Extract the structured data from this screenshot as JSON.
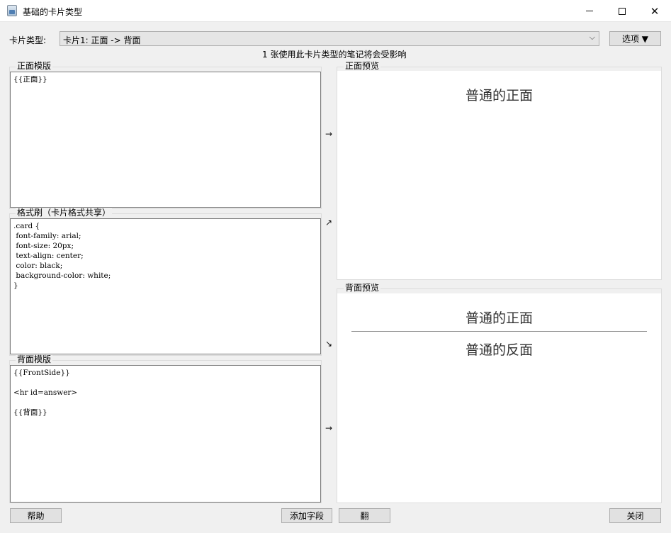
{
  "window": {
    "title": "基础的卡片类型",
    "minimize_glyph": "",
    "close_glyph": "✕"
  },
  "header": {
    "card_type_label": "卡片类型:",
    "card_type_value": "卡片1: 正面 -> 背面",
    "dropdown_arrow": "⌵",
    "options_button": "选项 ▼",
    "notice": "1 张使用此卡片类型的笔记将会受影响"
  },
  "front_template": {
    "title": "正面模版",
    "content": "{{正面}}"
  },
  "styling": {
    "title": "格式刷（卡片格式共享）",
    "content": ".card {\n font-family: arial;\n font-size: 20px;\n text-align: center;\n color: black;\n background-color: white;\n}"
  },
  "back_template": {
    "title": "背面模版",
    "content": "{{FrontSide}}\n\n<hr id=answer>\n\n{{背面}}"
  },
  "arrows": {
    "front": "→",
    "styling_up": "↗",
    "styling_down": "↘",
    "back": "→"
  },
  "front_preview": {
    "title": "正面预览",
    "text": "普通的正面"
  },
  "back_preview": {
    "title": "背面预览",
    "question": "普通的正面",
    "answer": "普通的反面"
  },
  "footer": {
    "help": "帮助",
    "add_field": "添加字段",
    "flip": "翻",
    "close": "关闭"
  }
}
